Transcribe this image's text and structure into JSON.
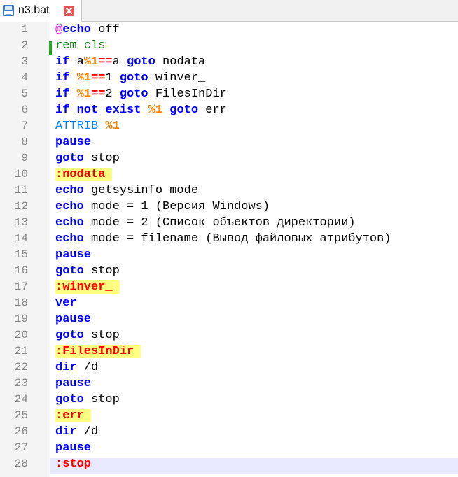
{
  "tab": {
    "title": "n3.bat",
    "icons": {
      "save": "save-icon",
      "close": "close-icon"
    }
  },
  "line_numbers": [
    "1",
    "2",
    "3",
    "4",
    "5",
    "6",
    "7",
    "8",
    "9",
    "10",
    "11",
    "12",
    "13",
    "14",
    "15",
    "16",
    "17",
    "18",
    "19",
    "20",
    "21",
    "22",
    "23",
    "24",
    "25",
    "26",
    "27",
    "28"
  ],
  "code": [
    [
      {
        "t": "@",
        "c": "at"
      },
      {
        "t": "echo",
        "c": "kw"
      },
      {
        "t": " off",
        "c": "n"
      }
    ],
    [
      {
        "t": "rem cls",
        "c": "cmt"
      }
    ],
    [
      {
        "t": "if",
        "c": "kw"
      },
      {
        "t": " a",
        "c": "n"
      },
      {
        "t": "%1",
        "c": "var"
      },
      {
        "t": "==",
        "c": "op"
      },
      {
        "t": "a ",
        "c": "n"
      },
      {
        "t": "goto",
        "c": "kw"
      },
      {
        "t": " nodata",
        "c": "n"
      }
    ],
    [
      {
        "t": "if",
        "c": "kw"
      },
      {
        "t": " ",
        "c": "n"
      },
      {
        "t": "%1",
        "c": "var"
      },
      {
        "t": "==",
        "c": "op"
      },
      {
        "t": "1 ",
        "c": "n"
      },
      {
        "t": "goto",
        "c": "kw"
      },
      {
        "t": " winver_",
        "c": "n"
      }
    ],
    [
      {
        "t": "if",
        "c": "kw"
      },
      {
        "t": " ",
        "c": "n"
      },
      {
        "t": "%1",
        "c": "var"
      },
      {
        "t": "==",
        "c": "op"
      },
      {
        "t": "2 ",
        "c": "n"
      },
      {
        "t": "goto",
        "c": "kw"
      },
      {
        "t": " FilesInDir",
        "c": "n"
      }
    ],
    [
      {
        "t": "if",
        "c": "kw"
      },
      {
        "t": " ",
        "c": "n"
      },
      {
        "t": "not",
        "c": "kw"
      },
      {
        "t": " ",
        "c": "n"
      },
      {
        "t": "exist",
        "c": "kw"
      },
      {
        "t": " ",
        "c": "n"
      },
      {
        "t": "%1",
        "c": "var"
      },
      {
        "t": " ",
        "c": "n"
      },
      {
        "t": "goto",
        "c": "kw"
      },
      {
        "t": " err",
        "c": "n"
      }
    ],
    [
      {
        "t": "ATTRIB",
        "c": "attr"
      },
      {
        "t": " ",
        "c": "n"
      },
      {
        "t": "%1",
        "c": "var"
      }
    ],
    [
      {
        "t": "pause",
        "c": "kw"
      }
    ],
    [
      {
        "t": "goto",
        "c": "kw"
      },
      {
        "t": " stop",
        "c": "n"
      }
    ],
    [
      {
        "t": ":nodata",
        "c": "lbl"
      }
    ],
    [
      {
        "t": "echo",
        "c": "kw"
      },
      {
        "t": " getsysinfo mode",
        "c": "n"
      }
    ],
    [
      {
        "t": "echo",
        "c": "kw"
      },
      {
        "t": " mode = 1 (Версия Windows)",
        "c": "n"
      }
    ],
    [
      {
        "t": "echo",
        "c": "kw"
      },
      {
        "t": " mode = 2 (Список объектов директории)",
        "c": "n"
      }
    ],
    [
      {
        "t": "echo",
        "c": "kw"
      },
      {
        "t": " mode = filename (Вывод файловых атрибутов)",
        "c": "n"
      }
    ],
    [
      {
        "t": "pause",
        "c": "kw"
      }
    ],
    [
      {
        "t": "goto",
        "c": "kw"
      },
      {
        "t": " stop",
        "c": "n"
      }
    ],
    [
      {
        "t": ":winver_",
        "c": "lbl"
      }
    ],
    [
      {
        "t": "ver",
        "c": "kw"
      }
    ],
    [
      {
        "t": "pause",
        "c": "kw"
      }
    ],
    [
      {
        "t": "goto",
        "c": "kw"
      },
      {
        "t": " stop",
        "c": "n"
      }
    ],
    [
      {
        "t": ":FilesInDir",
        "c": "lbl"
      }
    ],
    [
      {
        "t": "dir",
        "c": "kw"
      },
      {
        "t": " /d",
        "c": "n"
      }
    ],
    [
      {
        "t": "pause",
        "c": "kw"
      }
    ],
    [
      {
        "t": "goto",
        "c": "kw"
      },
      {
        "t": " stop",
        "c": "n"
      }
    ],
    [
      {
        "t": ":err",
        "c": "lbl"
      }
    ],
    [
      {
        "t": "dir",
        "c": "kw"
      },
      {
        "t": " /d",
        "c": "n"
      }
    ],
    [
      {
        "t": "pause",
        "c": "kw"
      }
    ],
    [
      {
        "t": ":stop",
        "c": "op"
      }
    ]
  ],
  "colors": {
    "keyword": "#0000ff",
    "at_sign": "#ff00ff",
    "variable": "#ff8000",
    "comment": "#008000",
    "attrib": "#0080ff",
    "operator": "#ff0000",
    "label_highlight": "#ffff80",
    "current_line": "#e8e8ff"
  }
}
